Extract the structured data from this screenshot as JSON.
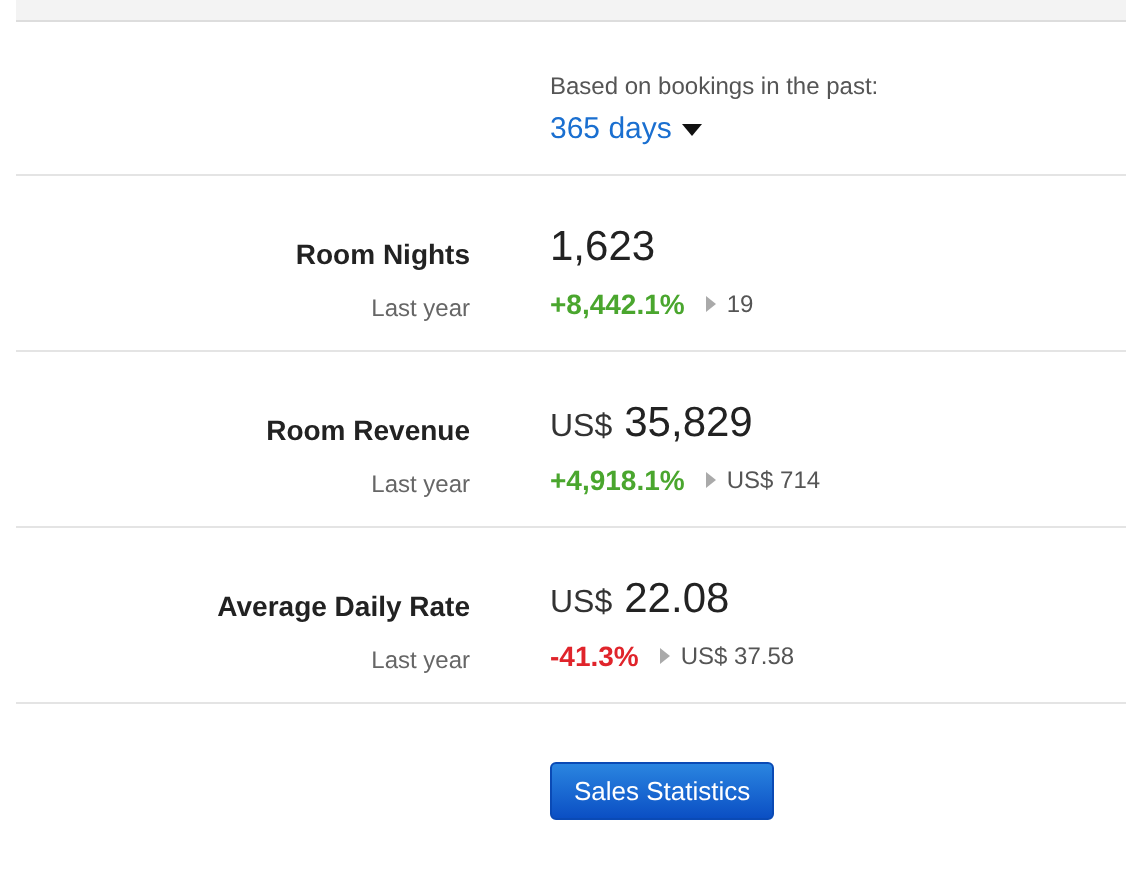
{
  "period": {
    "caption": "Based on bookings in the past:",
    "value": "365 days"
  },
  "metrics": [
    {
      "label": "Room Nights",
      "value": "1,623",
      "compare_label": "Last year",
      "change": "+8,442.1%",
      "color": "#4aa62e",
      "previous": "19"
    },
    {
      "label": "Room Revenue",
      "currency": "US$",
      "value": "35,829",
      "compare_label": "Last year",
      "change": "+4,918.1%",
      "color": "#4aa62e",
      "previous": "US$ 714"
    },
    {
      "label": "Average Daily Rate",
      "currency": "US$",
      "value": "22.08",
      "compare_label": "Last year",
      "change": "-41.3%",
      "color": "#e0242b",
      "previous": "US$ 37.58"
    }
  ],
  "button": "Sales Statistics"
}
